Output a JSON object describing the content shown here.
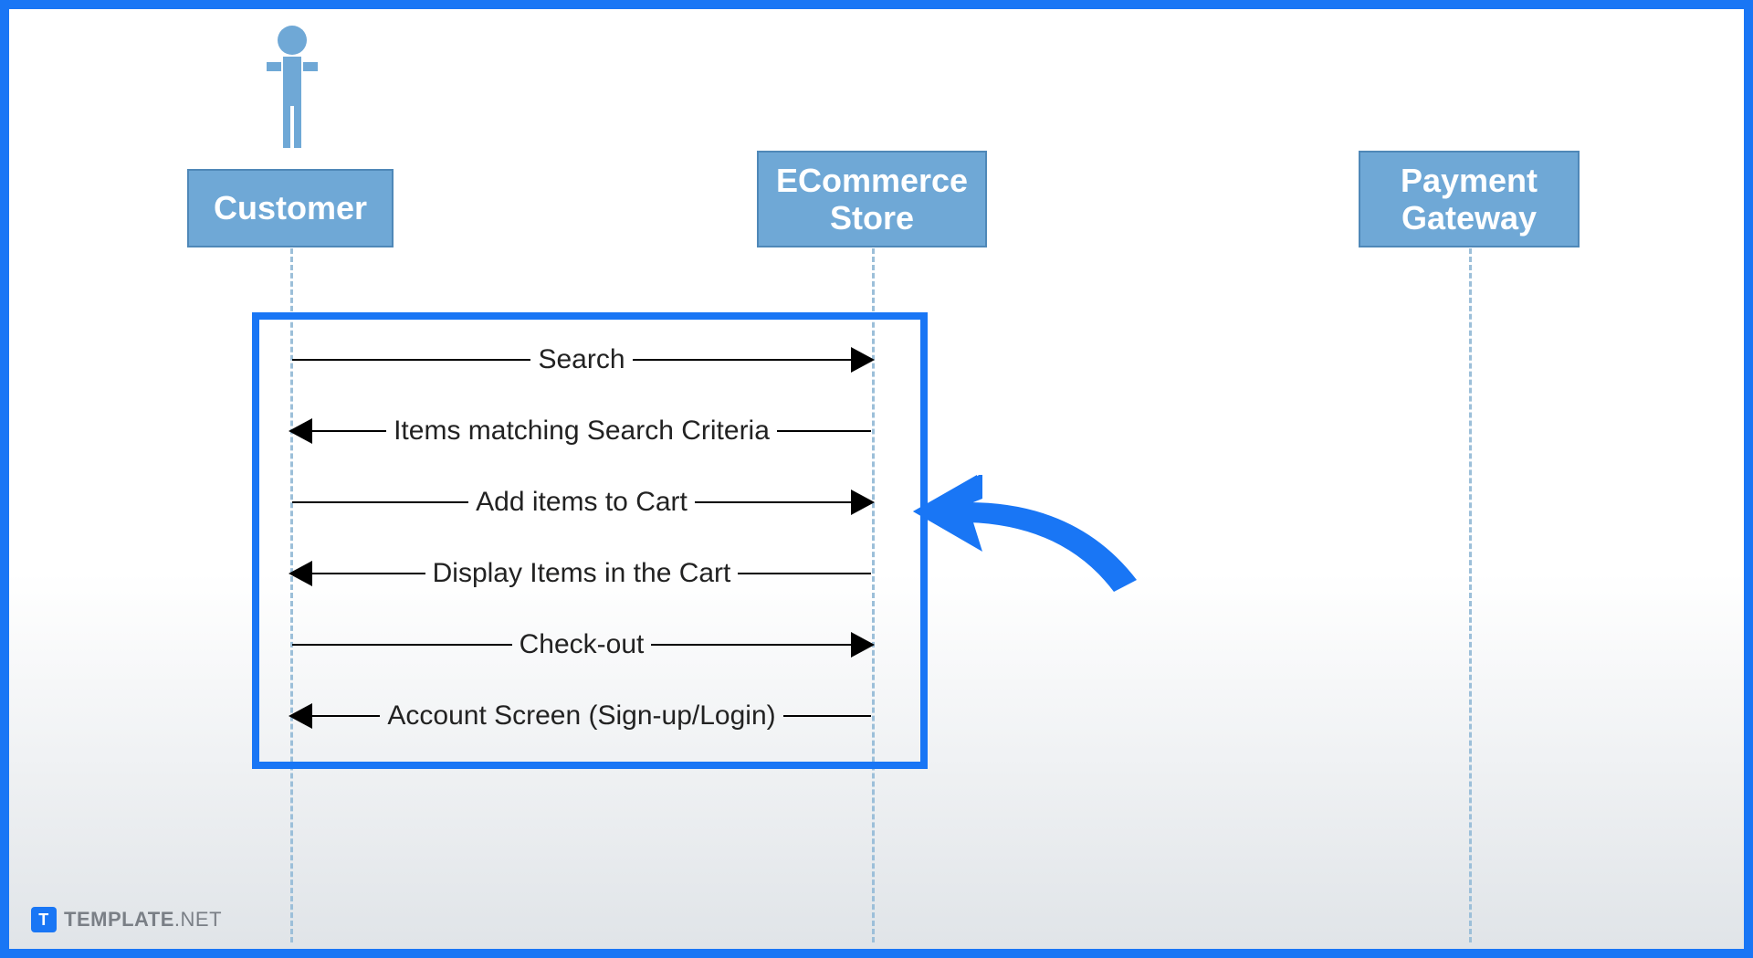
{
  "participants": {
    "customer": {
      "label": "Customer"
    },
    "store": {
      "label_line1": "ECommerce",
      "label_line2": "Store"
    },
    "gateway": {
      "label_line1": "Payment",
      "label_line2": "Gateway"
    }
  },
  "messages": [
    {
      "direction": "right",
      "label": "Search"
    },
    {
      "direction": "left",
      "label": "Items matching Search Criteria"
    },
    {
      "direction": "right",
      "label": "Add items to Cart"
    },
    {
      "direction": "left",
      "label": "Display Items in the Cart"
    },
    {
      "direction": "right",
      "label": "Check-out"
    },
    {
      "direction": "left",
      "label": "Account Screen (Sign-up/Login)"
    }
  ],
  "watermark": {
    "logo_letter": "T",
    "brand_bold": "TEMPLATE",
    "brand_ext": ".NET"
  },
  "colors": {
    "frame": "#1976f5",
    "box_fill": "#6fa8d6",
    "box_border": "#4f88b8",
    "lifeline": "#9cbfd9",
    "pointer": "#1976f5"
  }
}
